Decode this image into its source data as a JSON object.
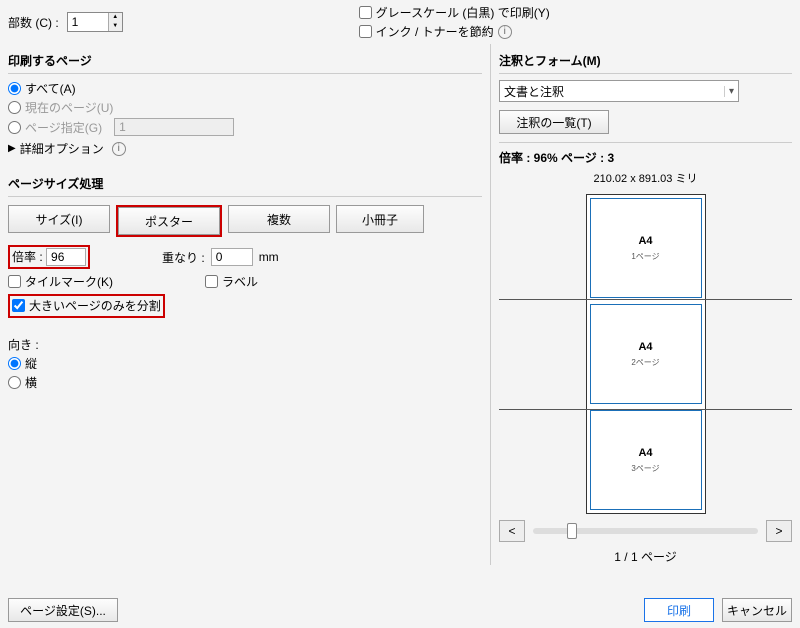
{
  "top": {
    "copies_label": "部数 (C) :",
    "copies_value": "1",
    "grayscale": "グレースケール (白黒) で印刷(Y)",
    "save_ink": "インク / トナーを節約"
  },
  "pages": {
    "title": "印刷するページ",
    "all": "すべて(A)",
    "current": "現在のページ(U)",
    "range": "ページ指定(G)",
    "range_value": "1",
    "advanced": "詳細オプション"
  },
  "size": {
    "title": "ページサイズ処理",
    "btn_size": "サイズ(I)",
    "btn_poster": "ポスター",
    "btn_multi": "複数",
    "btn_booklet": "小冊子",
    "scale_label": "倍率 :",
    "scale_value": "96",
    "overlap_label": "重なり :",
    "overlap_value": "0",
    "overlap_unit": "mm",
    "tile_marks": "タイルマーク(K)",
    "labels_chk": "ラベル",
    "split_large": "大きいページのみを分割"
  },
  "orient": {
    "title": "向き :",
    "portrait": "縦",
    "landscape": "横"
  },
  "right": {
    "title": "注釈とフォーム(M)",
    "dropdown": "文書と注釈",
    "list_btn": "注釈の一覧(T)",
    "scale_info": "倍率 : 96%  ページ : 3",
    "dim": "210.02 x 891.03 ミリ",
    "a4": "A4",
    "p1": "1ページ",
    "p2": "2ページ",
    "p3": "3ページ",
    "prev": "<",
    "next": ">",
    "page_of": "1 / 1 ページ"
  },
  "bottom": {
    "page_setup": "ページ設定(S)...",
    "print": "印刷",
    "cancel": "キャンセル"
  }
}
